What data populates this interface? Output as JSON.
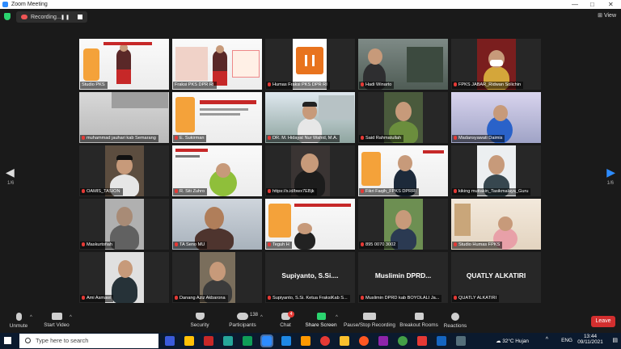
{
  "window": {
    "title": "Zoom Meeting"
  },
  "top_bar": {
    "recording_label": "Recording...",
    "view_label": "View"
  },
  "participants": [
    {
      "name": "Studio PKS",
      "muted": false
    },
    {
      "name": "Fraksi PKS DPR RI",
      "muted": false
    },
    {
      "name": "Humas Fraksi PKS DPR RI",
      "muted": true
    },
    {
      "name": "Hadi Winarto",
      "muted": true
    },
    {
      "name": "FPKS JABAR_Ridwan Solichin",
      "muted": true
    },
    {
      "name": "muhammad jauhari kab Semarang",
      "muted": true
    },
    {
      "name": "E. Sukirman",
      "muted": true
    },
    {
      "name": "DR. M. Hidayat Nur Wahid, M.A.",
      "muted": true
    },
    {
      "name": "Said Rahmatullah",
      "muted": true
    },
    {
      "name": "Madansyawati Daimis",
      "muted": true
    },
    {
      "name": "OAMIS_TASION",
      "muted": true
    },
    {
      "name": "R. Siti Zuhro",
      "muted": true
    },
    {
      "name": "https://s.id/bwx7EBjk",
      "muted": true
    },
    {
      "name": "Fikri Faqih_FPKS DPRRI",
      "muted": true
    },
    {
      "name": "kiking muttakin_Tasikmalaya_Guru",
      "muted": true
    },
    {
      "name": "Maskurtofiah",
      "muted": true
    },
    {
      "name": "TA Seno MU",
      "muted": true
    },
    {
      "name": "Teguh H",
      "muted": true
    },
    {
      "name": "895 0070 3002",
      "muted": true
    },
    {
      "name": "Studio Humas FPKS",
      "muted": true
    },
    {
      "name": "Ami Asmawi",
      "muted": true
    },
    {
      "name": "Danang Aziz Akbarona",
      "muted": true
    },
    {
      "name": "Supiyanto, S.Si. Ketua FraksiKab S...",
      "muted": true,
      "display": "Supiyanto, S.Si...."
    },
    {
      "name": "Muslimin DPRD kab BOYOLALI Ja...",
      "muted": true,
      "display": "Muslimin DPRD..."
    },
    {
      "name": "QUATLY ALKATIRI",
      "muted": true,
      "display": "QUATLY ALKATIRI"
    }
  ],
  "nav": {
    "page_left": "1/6",
    "page_right": "1/6"
  },
  "toolbar": {
    "unmute": "Unmute",
    "start_video": "Start Video",
    "security": "Security",
    "participants": "Participants",
    "participant_count": "138",
    "chat": "Chat",
    "chat_badge": "4",
    "share_screen": "Share Screen",
    "pause_recording": "Pause/Stop Recording",
    "breakout_rooms": "Breakout Rooms",
    "reactions": "Reactions",
    "leave": "Leave"
  },
  "taskbar": {
    "search_placeholder": "Type here to search",
    "weather": "32°C  Hujan",
    "language": "ENG",
    "time": "13:44",
    "date": "09/11/2021"
  },
  "colors": {
    "accent": "#2d8cff",
    "active_speaker": "#e3d200",
    "leave": "#d32f2f",
    "muted": "#e53935",
    "share": "#2bd46f"
  }
}
